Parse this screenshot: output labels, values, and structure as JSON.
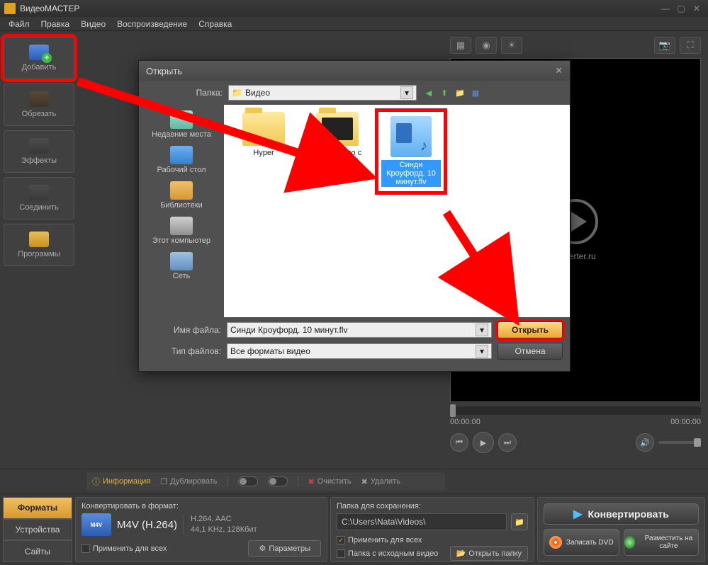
{
  "app": {
    "title": "ВидеоМАСТЕР"
  },
  "menu": [
    "Файл",
    "Правка",
    "Видео",
    "Воспроизведение",
    "Справка"
  ],
  "sidebar": {
    "add": "Добавить",
    "cut": "Обрезать",
    "fx": "Эффекты",
    "join": "Соединить",
    "prog": "Программы"
  },
  "toolbar": {
    "info": "Информация",
    "dup": "Дублировать",
    "clear": "Очистить",
    "del": "Удалить"
  },
  "preview": {
    "logo_text": "onverter.ru",
    "time_start": "00:00:00",
    "time_end": "00:00:00"
  },
  "formats": {
    "tabs": {
      "formats": "Форматы",
      "devices": "Устройства",
      "sites": "Сайты"
    },
    "hdr": "Конвертировать в формат:",
    "icon_label": "M4V",
    "name": "M4V (H.264)",
    "codec": "H.264, AAC",
    "audio": "44,1 KHz, 128Кбит",
    "apply_all": "Применить для всех",
    "params": "Параметры"
  },
  "save": {
    "hdr": "Папка для сохранения:",
    "path": "C:\\Users\\Nata\\Videos\\",
    "apply_all": "Применить для всех",
    "src_folder": "Папка с исходным видео",
    "open_folder": "Открыть папку"
  },
  "actions": {
    "convert": "Конвертировать",
    "dvd": "Записать DVD",
    "web": "Разместить на сайте"
  },
  "dialog": {
    "title": "Открыть",
    "folder_label": "Папка:",
    "folder_value": "Видео",
    "places": {
      "recent": "Недавние места",
      "desktop": "Рабочий стол",
      "libs": "Библиотеки",
      "pc": "Этот компьютер",
      "net": "Сеть"
    },
    "files": {
      "hyper": "Hyper",
      "win10": "Знакомство с Windows 10",
      "crawford": "Синди Кроуфорд. 10 минут.flv"
    },
    "filename_label": "Имя файла:",
    "filename_value": "Синди Кроуфорд. 10 минут.flv",
    "filetype_label": "Тип файлов:",
    "filetype_value": "Все форматы видео",
    "open_btn": "Открыть",
    "cancel_btn": "Отмена"
  }
}
